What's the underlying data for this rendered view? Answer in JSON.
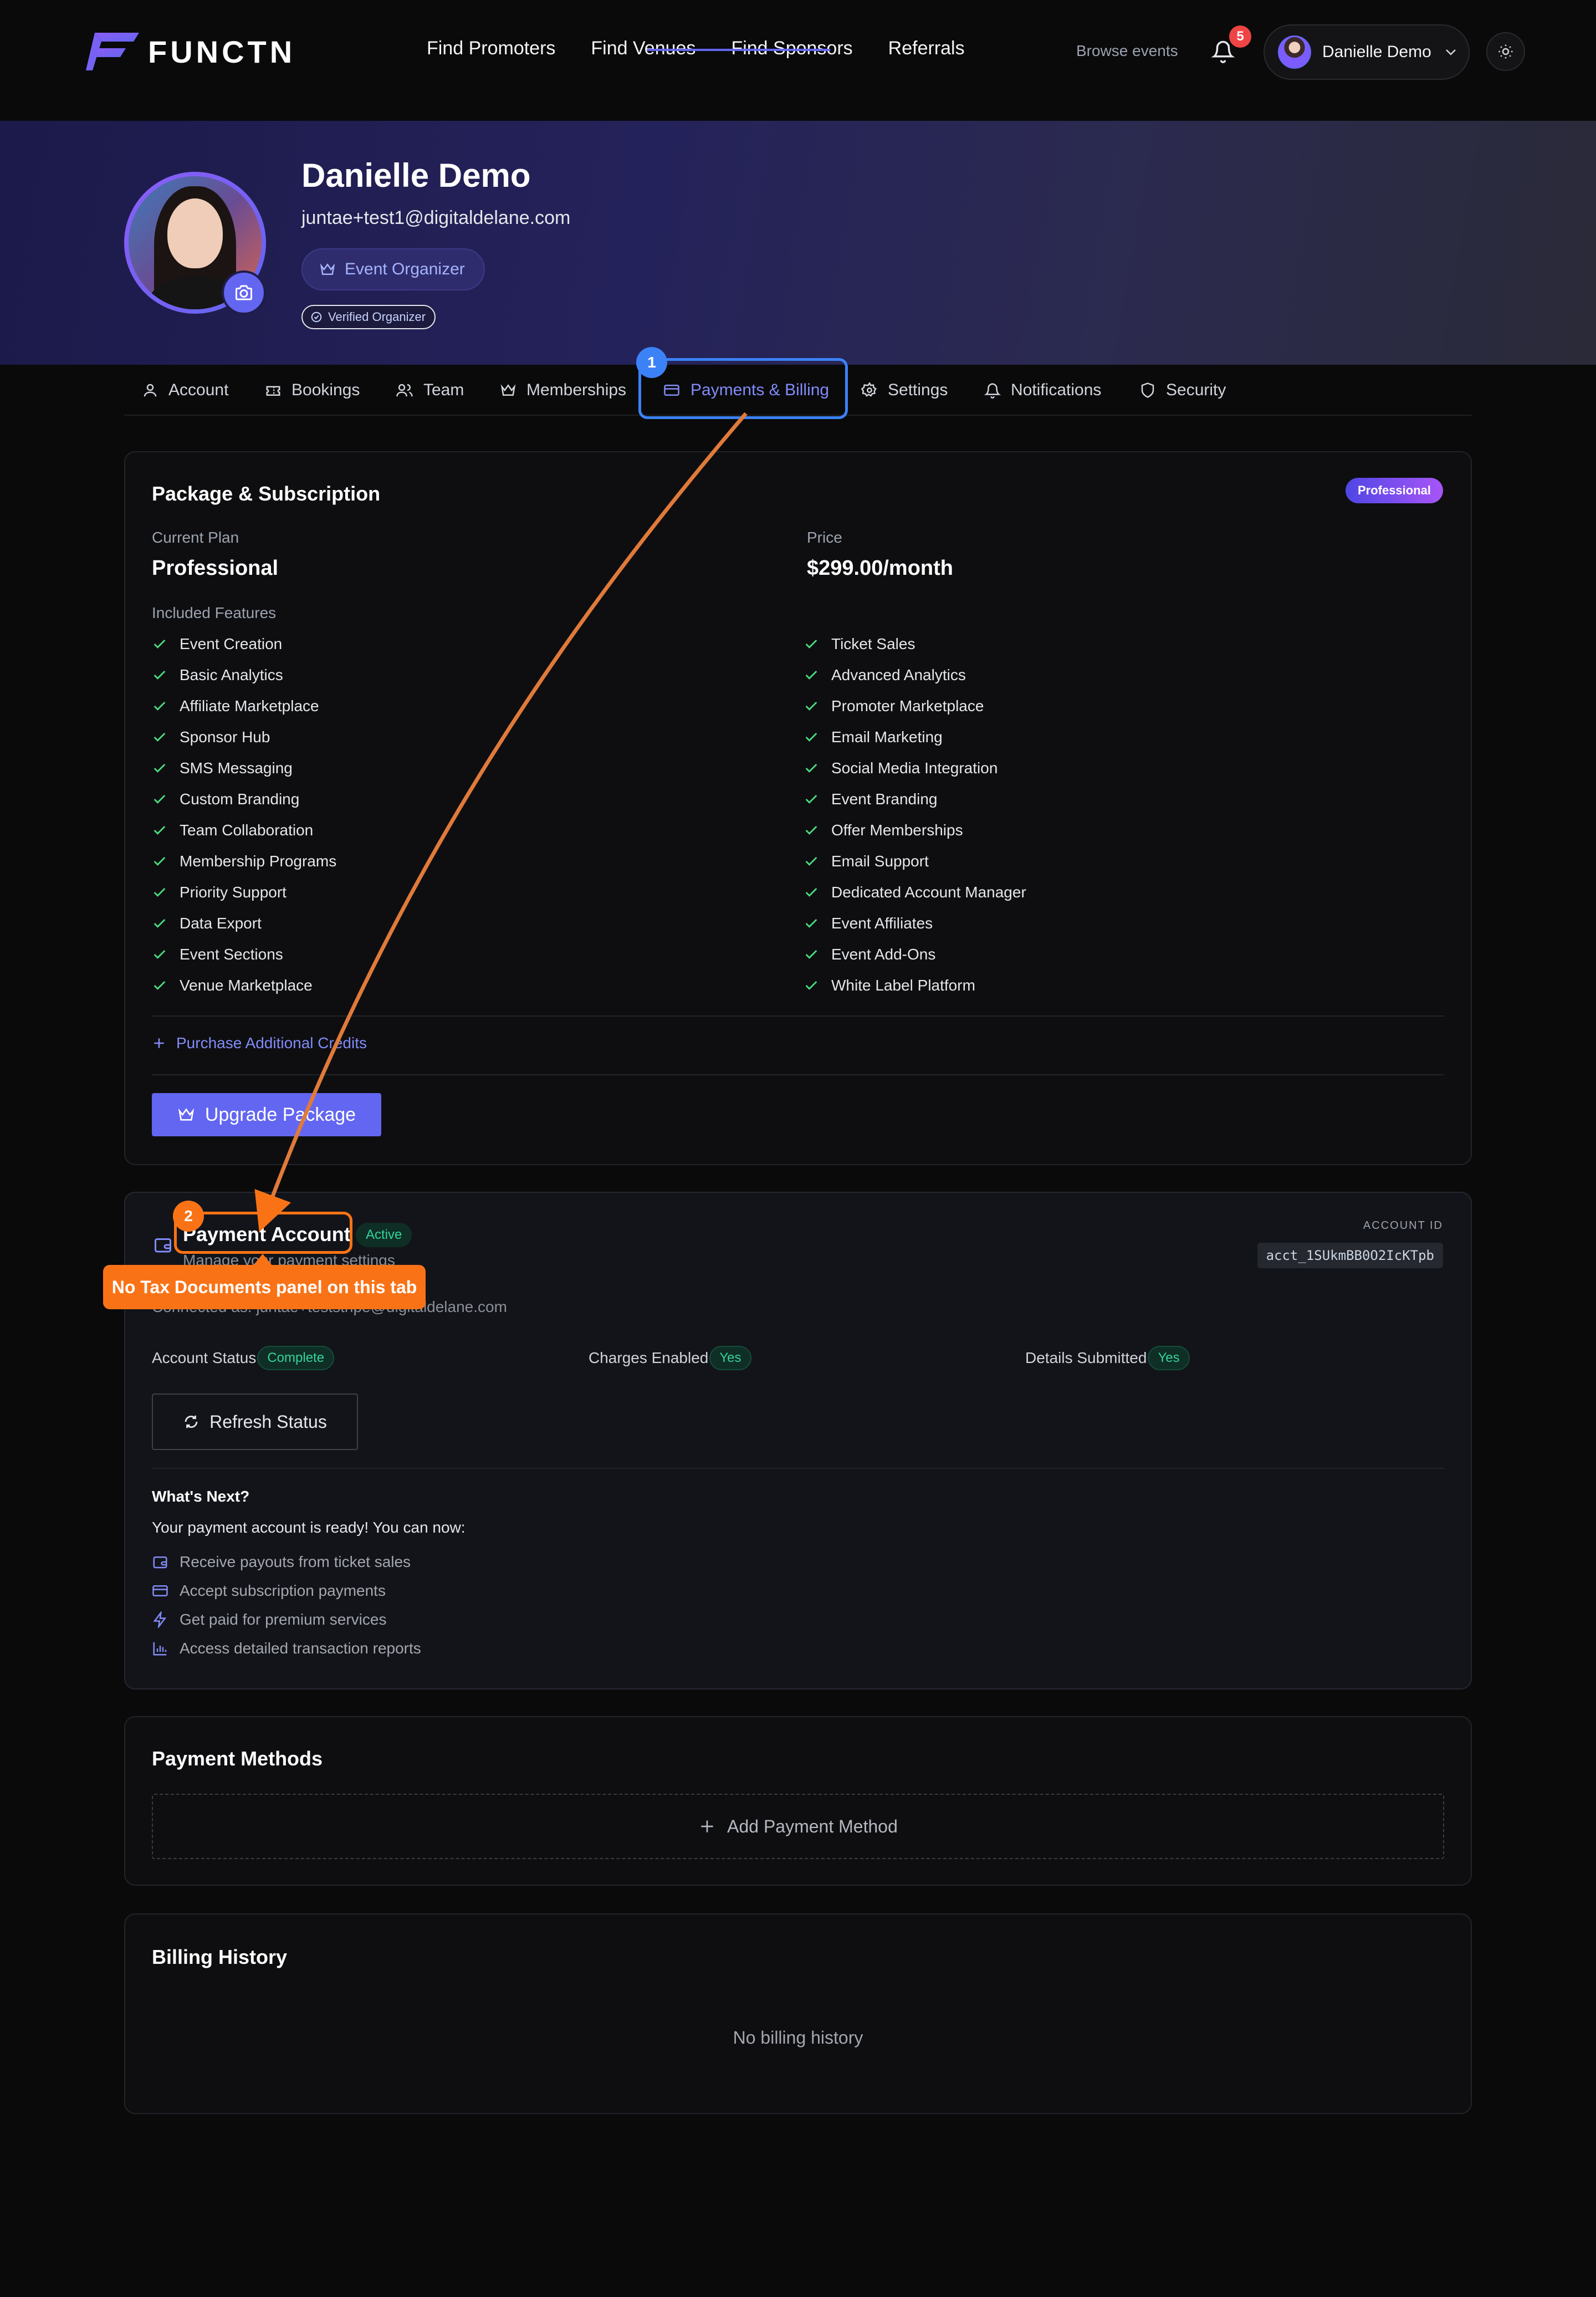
{
  "nav": {
    "brand": "FUNCTN",
    "links": [
      "Find Promoters",
      "Find Venues",
      "Find Sponsors",
      "Referrals"
    ],
    "browse_events": "Browse events",
    "notification_count": "5",
    "user_name": "Danielle Demo"
  },
  "profile": {
    "name": "Danielle Demo",
    "email": "juntae+test1@digitaldelane.com",
    "role": "Event Organizer",
    "verified": "Verified Organizer"
  },
  "tabs": [
    {
      "label": "Account",
      "icon": "user-icon"
    },
    {
      "label": "Bookings",
      "icon": "ticket-icon"
    },
    {
      "label": "Team",
      "icon": "users-icon"
    },
    {
      "label": "Memberships",
      "icon": "crown-icon"
    },
    {
      "label": "Payments & Billing",
      "icon": "credit-card-icon",
      "active": true
    },
    {
      "label": "Settings",
      "icon": "gear-icon"
    },
    {
      "label": "Notifications",
      "icon": "bell-icon"
    },
    {
      "label": "Security",
      "icon": "shield-icon"
    }
  ],
  "package": {
    "title": "Package & Subscription",
    "badge": "Professional",
    "current_plan_label": "Current Plan",
    "current_plan": "Professional",
    "price_label": "Price",
    "price": "$299.00/month",
    "features_label": "Included Features",
    "features_left": [
      "Event Creation",
      "Basic Analytics",
      "Affiliate Marketplace",
      "Sponsor Hub",
      "SMS Messaging",
      "Custom Branding",
      "Team Collaboration",
      "Membership Programs",
      "Priority Support",
      "Data Export",
      "Event Sections",
      "Venue Marketplace"
    ],
    "features_right": [
      "Ticket Sales",
      "Advanced Analytics",
      "Promoter Marketplace",
      "Email Marketing",
      "Social Media Integration",
      "Event Branding",
      "Offer Memberships",
      "Email Support",
      "Dedicated Account Manager",
      "Event Affiliates",
      "Event Add-Ons",
      "White Label Platform"
    ],
    "purchase_credits": "Purchase Additional Credits",
    "upgrade": "Upgrade Package"
  },
  "payment_account": {
    "title": "Payment Account",
    "status_badge": "Active",
    "subtitle": "Manage your payment settings",
    "connected_as": "Connected as: juntae+teststripe@digitaldelane.com",
    "account_id_label": "ACCOUNT ID",
    "account_id": "acct_1SUkmBB0O2IcKTpb",
    "account_status_label": "Account Status",
    "account_status": "Complete",
    "charges_label": "Charges Enabled",
    "charges": "Yes",
    "details_label": "Details Submitted",
    "details": "Yes",
    "refresh": "Refresh Status",
    "whats_next": "What's Next?",
    "ready_text": "Your payment account is ready! You can now:",
    "next_items": [
      {
        "label": "Receive payouts from ticket sales",
        "icon": "wallet-icon"
      },
      {
        "label": "Accept subscription payments",
        "icon": "credit-card-icon"
      },
      {
        "label": "Get paid for premium services",
        "icon": "lightning-icon"
      },
      {
        "label": "Access detailed transaction reports",
        "icon": "bar-chart-icon"
      }
    ]
  },
  "payment_methods": {
    "title": "Payment Methods",
    "add": "Add Payment Method"
  },
  "billing_history": {
    "title": "Billing History",
    "empty": "No billing history"
  },
  "annotations": {
    "step1": "1",
    "step2": "2",
    "callout": "No Tax Documents panel on this tab",
    "colors": {
      "blue": "#3b82f6",
      "orange": "#f97316"
    }
  }
}
